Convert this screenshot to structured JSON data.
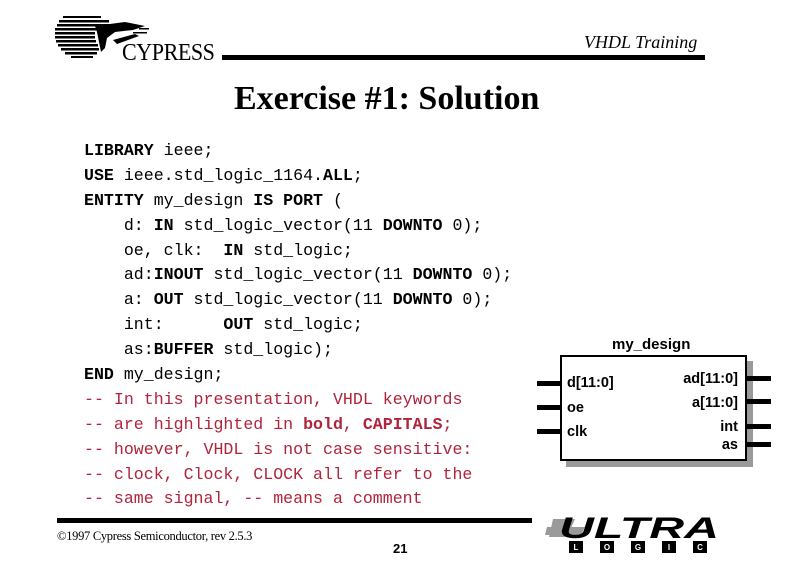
{
  "header": {
    "logo_text": "CYPRESS",
    "course_title": "VHDL Training"
  },
  "slide": {
    "title": "Exercise #1: Solution",
    "page_number": "21"
  },
  "code": {
    "lines": [
      [
        {
          "t": "LIBRARY",
          "b": true
        },
        {
          "t": " ieee;"
        }
      ],
      [
        {
          "t": "USE",
          "b": true
        },
        {
          "t": " ieee.std_logic_1164."
        },
        {
          "t": "ALL",
          "b": true
        },
        {
          "t": ";"
        }
      ],
      [
        {
          "t": "ENTITY",
          "b": true
        },
        {
          "t": " my_design "
        },
        {
          "t": "IS PORT",
          "b": true
        },
        {
          "t": " ("
        }
      ],
      [
        {
          "t": "    d: "
        },
        {
          "t": "IN",
          "b": true
        },
        {
          "t": " std_logic_vector(11 "
        },
        {
          "t": "DOWNTO",
          "b": true
        },
        {
          "t": " 0);"
        }
      ],
      [
        {
          "t": "    oe, clk:  "
        },
        {
          "t": "IN",
          "b": true
        },
        {
          "t": " std_logic;"
        }
      ],
      [
        {
          "t": "    ad:"
        },
        {
          "t": "INOUT",
          "b": true
        },
        {
          "t": " std_logic_vector(11 "
        },
        {
          "t": "DOWNTO",
          "b": true
        },
        {
          "t": " 0);"
        }
      ],
      [
        {
          "t": "    a: "
        },
        {
          "t": "OUT",
          "b": true
        },
        {
          "t": " std_logic_vector(11 "
        },
        {
          "t": "DOWNTO",
          "b": true
        },
        {
          "t": " 0);"
        }
      ],
      [
        {
          "t": "    int:      "
        },
        {
          "t": "OUT",
          "b": true
        },
        {
          "t": " std_logic;"
        }
      ],
      [
        {
          "t": "    as:"
        },
        {
          "t": "BUFFER",
          "b": true
        },
        {
          "t": " std_logic);"
        }
      ],
      [
        {
          "t": "END",
          "b": true
        },
        {
          "t": " my_design;"
        }
      ],
      [
        {
          "t": "-- In this presentation, VHDL keywords",
          "c": true
        }
      ],
      [
        {
          "t": "-- are highlighted in ",
          "c": true
        },
        {
          "t": "bold",
          "c": true,
          "b": true
        },
        {
          "t": ", ",
          "c": true
        },
        {
          "t": "CAPITALS",
          "c": true,
          "b": true
        },
        {
          "t": ";",
          "c": true
        }
      ],
      [
        {
          "t": "-- however, VHDL is not case sensitive:",
          "c": true
        }
      ],
      [
        {
          "t": "-- clock, Clock, CLOCK all refer to the",
          "c": true
        }
      ],
      [
        {
          "t": "-- same signal, -- means a comment",
          "c": true
        }
      ]
    ],
    "comment_color": "#b0243c"
  },
  "diagram": {
    "entity_name": "my_design",
    "inputs": [
      "d[11:0]",
      "oe",
      "clk"
    ],
    "outputs": [
      "ad[11:0]",
      "a[11:0]",
      "int",
      "as"
    ]
  },
  "footer": {
    "copyright": "©1997 Cypress Semiconductor, rev 2.5.3",
    "ultra_logo_text": "ULTRA",
    "ultra_logo_sub": [
      "L",
      "O",
      "G",
      "I",
      "C"
    ]
  }
}
